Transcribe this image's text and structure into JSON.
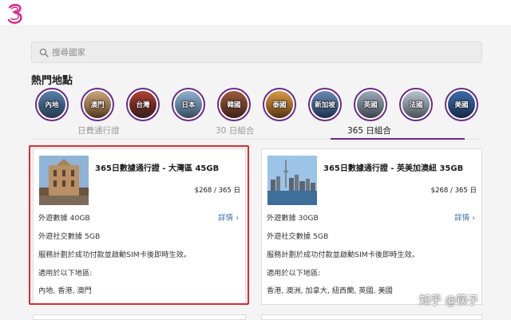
{
  "search": {
    "placeholder": "搜尋國家"
  },
  "popular": {
    "title": "熱門地點",
    "destinations": [
      "內地",
      "澳門",
      "台灣",
      "日本",
      "韓國",
      "泰國",
      "新加坡",
      "英國",
      "法國",
      "美國"
    ]
  },
  "tabs": {
    "items": [
      "日費通行證",
      "30 日組合",
      "365 日組合"
    ],
    "active": "365 日組合"
  },
  "cards": [
    {
      "title": "365日數據通行證 - 大灣區 45GB",
      "price": "$268 / 365 日",
      "data_label": "外遊數據 40GB",
      "detail_label": "詳情",
      "social_label": "外遊社交數據 5GB",
      "service_note": "服務計劃於成功付款並啟動SIM卡後即時生效。",
      "applicable_label": "適用於以下地區:",
      "regions": "內地, 香港, 澳門"
    },
    {
      "title": "365日數據通行證 - 英美加澳紐 35GB",
      "price": "$268 / 365 日",
      "data_label": "外遊數據 30GB",
      "detail_label": "詳情",
      "social_label": "外遊社交數據 5GB",
      "service_note": "服務計劃於成功付款並啟動SIM卡後即時生效。",
      "applicable_label": "適用於以下地區:",
      "regions": "香港, 澳洲, 加拿大, 紐西蘭, 英國, 美國"
    }
  ],
  "watermark": "知乎 @筷子",
  "colors": {
    "accent": "#6b2a8c",
    "link": "#3a6ea8",
    "highlight": "#e02a2a",
    "logo": "#e0218a"
  }
}
